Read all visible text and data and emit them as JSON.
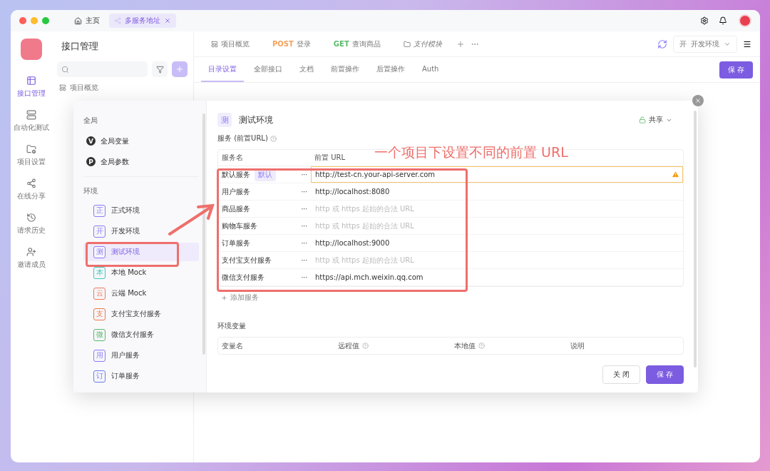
{
  "titlebar": {
    "tabs": [
      {
        "label": "主页",
        "selected": false,
        "closable": false
      },
      {
        "label": "多服务地址",
        "selected": true,
        "closable": true
      }
    ]
  },
  "rail": {
    "items": [
      {
        "label": "接口管理",
        "selected": true
      },
      {
        "label": "自动化测试",
        "selected": false
      },
      {
        "label": "项目设置",
        "selected": false
      },
      {
        "label": "在线分享",
        "selected": false
      },
      {
        "label": "请求历史",
        "selected": false
      },
      {
        "label": "邀请成员",
        "selected": false
      }
    ]
  },
  "panel": {
    "title": "接口管理",
    "tree": [
      {
        "label": "项目概览"
      }
    ]
  },
  "doc_tabs": [
    {
      "label": "项目概览",
      "italic": false
    },
    {
      "method": "POST",
      "label": "登录",
      "italic": false,
      "color": "#f5a25d"
    },
    {
      "method": "GET",
      "label": "查询商品",
      "italic": false,
      "color": "#5cba6a"
    },
    {
      "label": "支付模块",
      "italic": true
    }
  ],
  "env_selector": {
    "badge": "开",
    "label": "开发环境"
  },
  "sub_tabs": [
    {
      "label": "目录设置",
      "selected": true
    },
    {
      "label": "全部接口",
      "selected": false
    },
    {
      "label": "文档",
      "selected": false
    },
    {
      "label": "前置操作",
      "selected": false
    },
    {
      "label": "后置操作",
      "selected": false
    },
    {
      "label": "Auth",
      "selected": false
    }
  ],
  "save_button": "保 存",
  "modal": {
    "global_heading": "全局",
    "global_items": [
      {
        "badge": "V",
        "label": "全局变量"
      },
      {
        "badge": "P",
        "label": "全局参数"
      }
    ],
    "env_heading": "环境",
    "environments": [
      {
        "badge": "正",
        "label": "正式环境",
        "color": "#8b7cf6",
        "selected": false
      },
      {
        "badge": "开",
        "label": "开发环境",
        "color": "#8b7cf6",
        "selected": false
      },
      {
        "badge": "测",
        "label": "测试环境",
        "color": "#8b7cf6",
        "selected": true
      },
      {
        "badge": "本",
        "label": "本地 Mock",
        "color": "#3cc9c0",
        "selected": false
      },
      {
        "badge": "云",
        "label": "云端 Mock",
        "color": "#f07a5a",
        "selected": false
      },
      {
        "badge": "支",
        "label": "支付宝支付服务",
        "color": "#f0774a",
        "selected": false
      },
      {
        "badge": "微",
        "label": "微信支付服务",
        "color": "#5cba6a",
        "selected": false
      },
      {
        "badge": "用",
        "label": "用户服务",
        "color": "#8b7cf6",
        "selected": false
      },
      {
        "badge": "订",
        "label": "订单服务",
        "color": "#6b7cf0",
        "selected": false
      }
    ],
    "env_badge": "测",
    "env_title": "测试环境",
    "share": "共享",
    "services_heading": "服务 (前置URL)",
    "services_columns": [
      "服务名",
      "前置 URL"
    ],
    "services": [
      {
        "name": "默认服务",
        "tag": "默认",
        "url": "http://test-cn.your-api-server.com",
        "warning": true
      },
      {
        "name": "用户服务",
        "url": "http://localhost:8080",
        "warning": false
      },
      {
        "name": "商品服务",
        "placeholder": "http 或 https 起始的合法 URL",
        "warning": false
      },
      {
        "name": "购物车服务",
        "placeholder": "http 或 https 起始的合法 URL",
        "warning": false
      },
      {
        "name": "订单服务",
        "url": "http://localhost:9000",
        "warning": false
      },
      {
        "name": "支付宝支付服务",
        "placeholder": "http 或 https 起始的合法 URL",
        "warning": false
      },
      {
        "name": "微信支付服务",
        "url": "https://api.mch.weixin.qq.com",
        "warning": false
      }
    ],
    "more_mark": "···",
    "add_service": "添加服务",
    "vars_heading": "环境变量",
    "vars_columns": [
      {
        "label": "变量名",
        "help": false
      },
      {
        "label": "远程值",
        "help": true
      },
      {
        "label": "本地值",
        "help": true
      },
      {
        "label": "说明",
        "help": false
      }
    ],
    "buttons": [
      {
        "label": "关 闭",
        "primary": false
      },
      {
        "label": "保 存",
        "primary": true
      }
    ]
  },
  "annotation": "一个项目下设置不同的前置 URL"
}
